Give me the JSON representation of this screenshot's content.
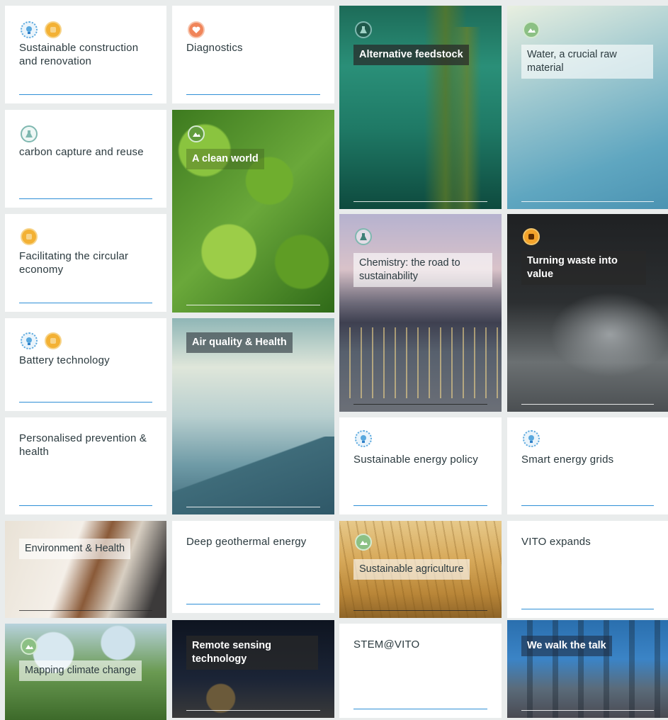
{
  "tiles": {
    "sustainable_construction": "Sustainable construction and renovation",
    "diagnostics": "Diagnostics",
    "alternative_feedstock": "Alternative feedstock",
    "water_raw_material": "Water, a crucial raw material",
    "carbon_capture": "carbon capture and reuse",
    "clean_world": "A clean world",
    "circular_economy": "Facilitating the circular economy",
    "chemistry": "Chemistry: the road to sustainability",
    "waste_value": "Turning waste into value",
    "battery": "Battery technology",
    "air_quality": "Air quality & Health",
    "personalised": "Personalised prevention & health",
    "energy_policy": "Sustainable energy policy",
    "energy_grids": "Smart energy grids",
    "environment_health": "Environment & Health",
    "geothermal": "Deep geothermal energy",
    "agriculture": "Sustainable agriculture",
    "vito_expands": "VITO expands",
    "mapping_climate": "Mapping climate change",
    "remote_sensing": "Remote sensing technology",
    "stem": "STEM@VITO",
    "walk_talk": "We walk the talk"
  },
  "icons": {
    "energy": "lightbulb-icon",
    "circular": "recycle-icon",
    "health": "heart-shield-icon",
    "chemistry": "flask-icon",
    "environment": "leaf-mountain-icon"
  },
  "colors": {
    "link_line": "#2f8fd6",
    "text": "#2b3a3f",
    "background": "#e9ecec"
  }
}
